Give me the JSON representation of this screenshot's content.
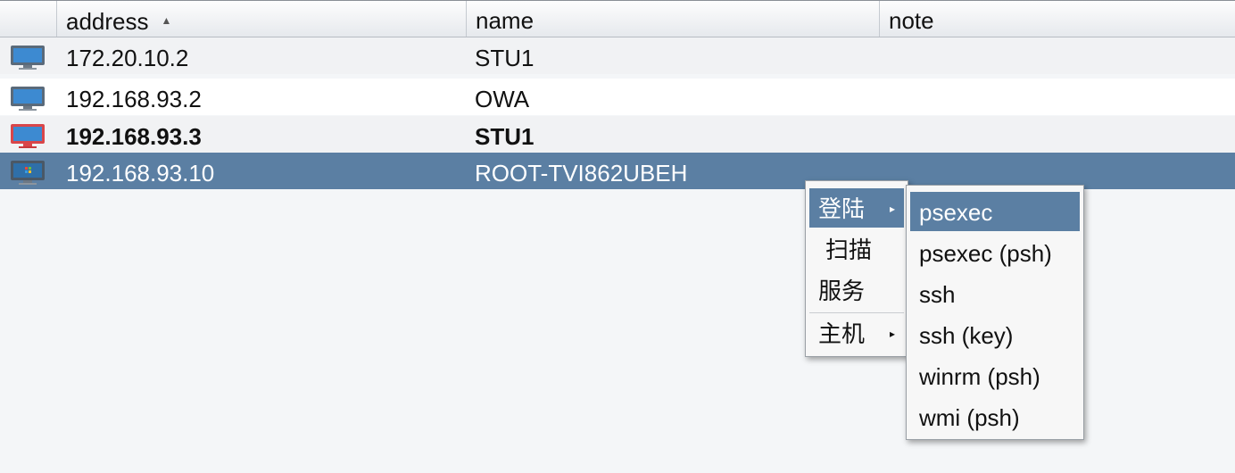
{
  "table": {
    "columns": {
      "address": "address",
      "name": "name",
      "note": "note"
    },
    "sort_indicator": "▲",
    "rows": [
      {
        "address": "172.20.10.2",
        "name": "STU1",
        "note": "",
        "icon": "monitor-icon"
      },
      {
        "address": "192.168.93.2",
        "name": "OWA",
        "note": "",
        "icon": "monitor-icon"
      },
      {
        "address": "192.168.93.3",
        "name": "STU1",
        "note": "",
        "icon": "monitor-compromised-icon",
        "bold": true
      },
      {
        "address": "192.168.93.10",
        "name": "ROOT-TVI862UBEH",
        "note": "",
        "icon": "windows-monitor-icon",
        "selected": true
      }
    ]
  },
  "context_menu": {
    "items": [
      "登陆",
      "扫描",
      "服务",
      "主机"
    ],
    "submenu_arrow": "▸"
  },
  "login_submenu": {
    "items": [
      "psexec",
      "psexec (psh)",
      "ssh",
      "ssh (key)",
      "winrm (psh)",
      "wmi (psh)"
    ]
  },
  "colors": {
    "selection": "#5b7fa3",
    "compromised_frame": "#d9464a"
  }
}
